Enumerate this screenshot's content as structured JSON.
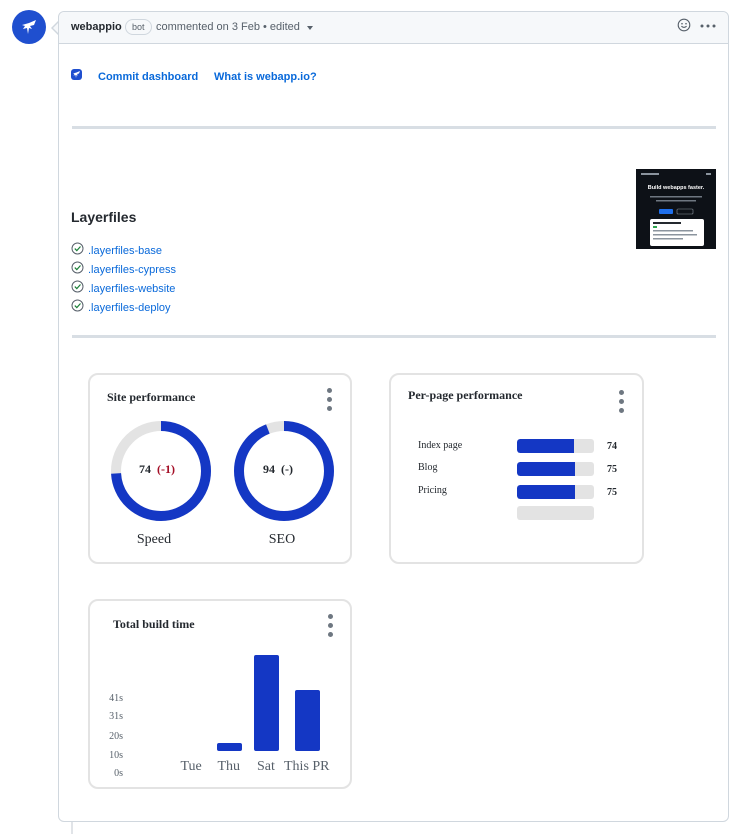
{
  "comment": {
    "author": "webappio",
    "badge": "bot",
    "meta": "commented on 3 Feb • edited"
  },
  "links": {
    "commit_dashboard": "Commit dashboard",
    "what_is": "What is webapp.io?"
  },
  "layerfiles": {
    "title": "Layerfiles",
    "items": [
      ".layerfiles-base",
      ".layerfiles-cypress",
      ".layerfiles-website",
      ".layerfiles-deploy"
    ]
  },
  "thumbnail": {
    "headline": "Build webapps faster."
  },
  "site_performance": {
    "title": "Site performance",
    "metrics": [
      {
        "label": "Speed",
        "value": "74",
        "delta": "(-1)",
        "score": 74
      },
      {
        "label": "SEO",
        "value": "94",
        "delta": "(-)",
        "score": 94
      }
    ]
  },
  "per_page": {
    "title": "Per-page performance",
    "rows": [
      {
        "label": "Index page",
        "value": "74",
        "score": 74
      },
      {
        "label": "Blog",
        "value": "75",
        "score": 75
      },
      {
        "label": "Pricing",
        "value": "75",
        "score": 75
      }
    ]
  },
  "chart_data": {
    "type": "bar",
    "title": "Total build time",
    "categories": [
      "Tue",
      "Thu",
      "Sat",
      "This PR"
    ],
    "values": [
      0,
      5,
      64,
      41
    ],
    "ytick_labels": [
      "0s",
      "10s",
      "20s",
      "31s",
      "41s"
    ],
    "ytick_values": [
      0,
      10,
      20,
      31,
      41
    ],
    "ylim": [
      0,
      64
    ]
  },
  "colors": {
    "accent": "#1437c4",
    "brand": "#1f4fcf",
    "link": "#0969da",
    "negative": "#a40e26"
  }
}
